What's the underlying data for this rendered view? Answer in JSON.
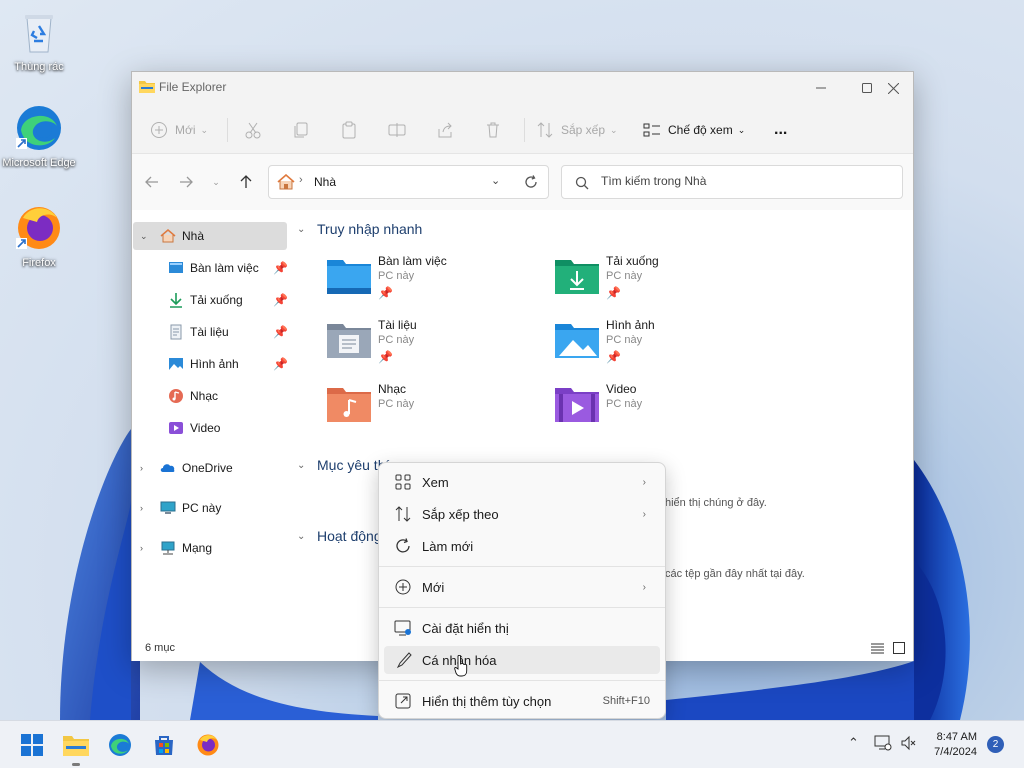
{
  "desktop": {
    "icons": [
      {
        "label": "Thùng rác",
        "icon": "recycle-bin-icon"
      },
      {
        "label": "Microsoft Edge",
        "icon": "edge-icon"
      },
      {
        "label": "Firefox",
        "icon": "firefox-icon"
      }
    ]
  },
  "window": {
    "title": "File Explorer",
    "toolbar": {
      "new_label": "Mới",
      "sort_label": "Sắp xếp",
      "view_label": "Chế độ xem",
      "more_label": "..."
    },
    "address": {
      "crumb": "Nhà"
    },
    "search": {
      "placeholder": "Tìm kiếm trong Nhà"
    },
    "sidebar": {
      "items": [
        {
          "label": "Nhà",
          "icon": "home-icon",
          "selected": true
        },
        {
          "label": "Bàn làm việc",
          "icon": "desktop-icon",
          "pinned": true
        },
        {
          "label": "Tải xuống",
          "icon": "download-icon",
          "pinned": true
        },
        {
          "label": "Tài liệu",
          "icon": "document-icon",
          "pinned": true
        },
        {
          "label": "Hình ảnh",
          "icon": "picture-icon",
          "pinned": true
        },
        {
          "label": "Nhạc",
          "icon": "music-icon"
        },
        {
          "label": "Video",
          "icon": "video-icon"
        },
        {
          "label": "OneDrive",
          "icon": "onedrive-icon"
        },
        {
          "label": "PC này",
          "icon": "pc-icon"
        },
        {
          "label": "Mạng",
          "icon": "network-icon"
        }
      ]
    },
    "content": {
      "quick_access_title": "Truy nhập nhanh",
      "quick_access": [
        {
          "name": "Bàn làm việc",
          "location": "PC này",
          "pinned": true,
          "icon": "desktop-folder-icon"
        },
        {
          "name": "Tải xuống",
          "location": "PC này",
          "pinned": true,
          "icon": "downloads-folder-icon"
        },
        {
          "name": "Tài liệu",
          "location": "PC này",
          "pinned": true,
          "icon": "documents-folder-icon"
        },
        {
          "name": "Hình ảnh",
          "location": "PC này",
          "pinned": true,
          "icon": "pictures-folder-icon"
        },
        {
          "name": "Nhạc",
          "location": "PC này",
          "pinned": false,
          "icon": "music-folder-icon"
        },
        {
          "name": "Video",
          "location": "PC này",
          "pinned": false,
          "icon": "videos-folder-icon"
        }
      ],
      "favorites_title": "Mục yêu thí",
      "favorites_hint": "hiển thị chúng ở đây.",
      "recent_title": "Hoạt động",
      "recent_hint": "các tệp gần đây nhất tại đây."
    },
    "status": {
      "count": "6 mục"
    }
  },
  "context_menu": {
    "items": [
      {
        "label": "Xem",
        "icon": "view-icon",
        "submenu": true
      },
      {
        "label": "Sắp xếp theo",
        "icon": "sort-icon",
        "submenu": true
      },
      {
        "label": "Làm mới",
        "icon": "refresh-icon",
        "submenu": false
      },
      {
        "label": "Mới",
        "icon": "new-icon",
        "submenu": true
      },
      {
        "label": "Cài đặt hiển thị",
        "icon": "display-settings-icon",
        "submenu": false
      },
      {
        "label": "Cá nhân hóa",
        "icon": "personalize-icon",
        "submenu": false,
        "hovered": true
      },
      {
        "label": "Hiển thị thêm tùy chọn",
        "icon": "more-options-icon",
        "submenu": false,
        "shortcut": "Shift+F10"
      }
    ]
  },
  "taskbar": {
    "apps": [
      "start-icon",
      "file-explorer-icon",
      "edge-icon",
      "store-icon",
      "firefox-icon"
    ],
    "time": "8:47 AM",
    "date": "7/4/2024",
    "notification_count": "2"
  },
  "colors": {
    "accent": "#0067c0",
    "header": "#1e3f6e",
    "badge": "#2f5fb8"
  }
}
